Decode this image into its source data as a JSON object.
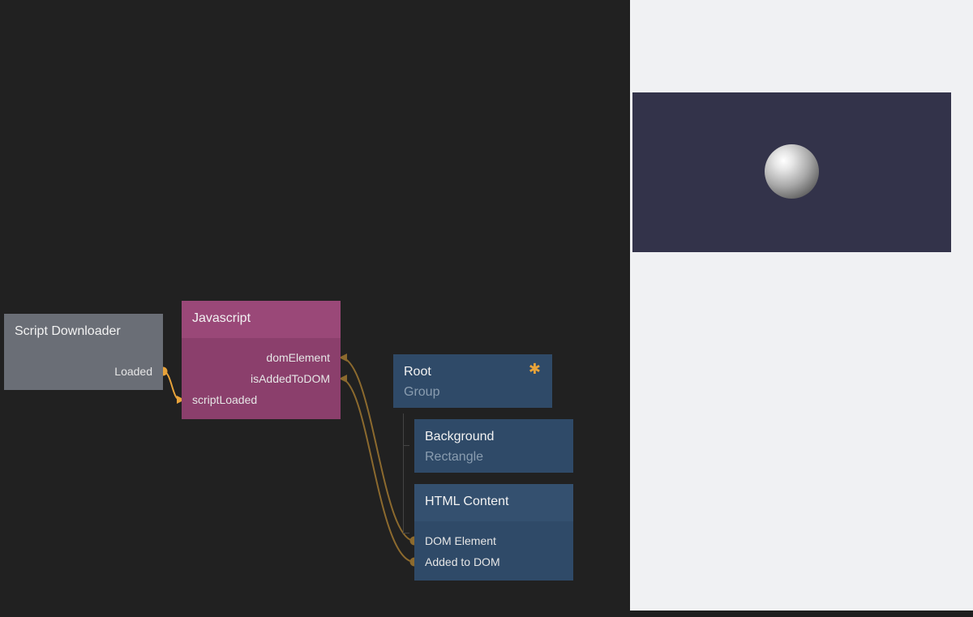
{
  "nodes": {
    "script_downloader": {
      "title": "Script Downloader",
      "outputs": [
        "Loaded"
      ]
    },
    "javascript": {
      "title": "Javascript",
      "outputs": [
        "domElement",
        "isAddedToDOM"
      ],
      "inputs": [
        "scriptLoaded"
      ]
    },
    "root": {
      "title": "Root",
      "subtitle": "Group",
      "marker": "✱"
    },
    "background": {
      "title": "Background",
      "subtitle": "Rectangle"
    },
    "html_content": {
      "title": "HTML Content",
      "inputs": [
        "DOM Element",
        "Added to DOM"
      ]
    }
  },
  "colors": {
    "canvas": "#212121",
    "preview_bg": "#f0f1f3",
    "viewport": "#33334a",
    "wire": "#8c6a2e",
    "wire_active": "#e8a33a",
    "script_node": "#6a6e76",
    "js_node": "#8b3f6c",
    "visual_node": "#2f4a68"
  },
  "icons": {
    "port": "circle-port-icon",
    "arrow_in": "arrow-input-icon",
    "sphere": "sphere-render"
  }
}
